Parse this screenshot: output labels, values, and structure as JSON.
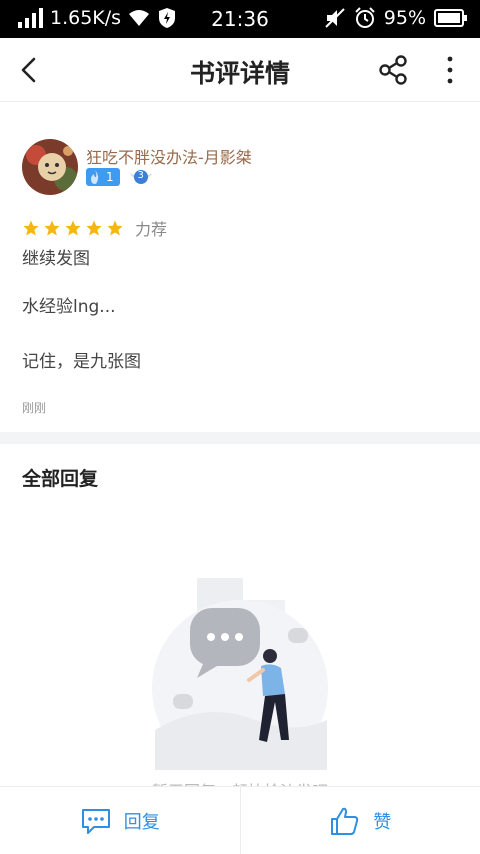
{
  "status_bar": {
    "net_speed": "1.65K/s",
    "time": "21:36",
    "battery": "95%"
  },
  "header": {
    "title": "书评详情"
  },
  "review": {
    "username": "狂吃不胖没办法-月影桀",
    "fan_level": "1",
    "vip_level": "3",
    "rating_stars": 5,
    "rating_label": "力荐",
    "lines": [
      "继续发图",
      "水经验lng...",
      "记住，是九张图"
    ],
    "time": "刚刚"
  },
  "replies": {
    "title": "全部回复",
    "empty_text": "暂无回复，赶快抢沙发吧"
  },
  "bottom_bar": {
    "reply_label": "回复",
    "like_label": "赞"
  },
  "colors": {
    "accent": "#2f8fe0",
    "star": "#f5b60f",
    "username": "#9a6a4a"
  }
}
